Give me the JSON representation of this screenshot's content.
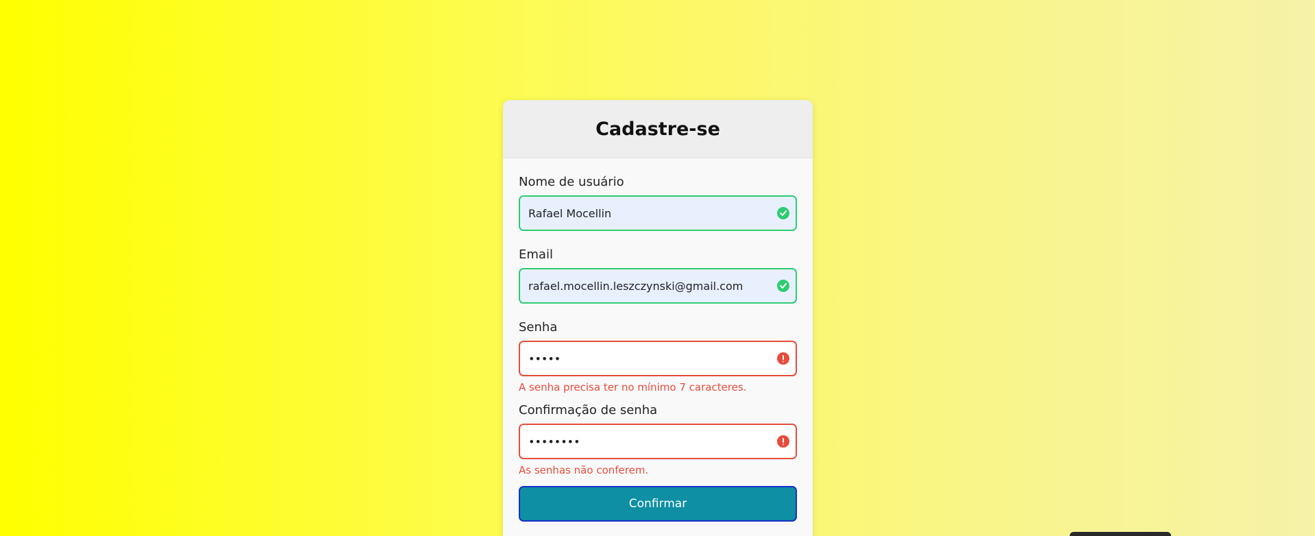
{
  "header": {
    "title": "Cadastre-se"
  },
  "fields": {
    "username": {
      "label": "Nome de usuário",
      "value": "Rafael Mocellin",
      "status": "success"
    },
    "email": {
      "label": "Email",
      "value": "rafael.mocellin.leszczynski@gmail.com",
      "status": "success"
    },
    "password": {
      "label": "Senha",
      "value": "•••••",
      "status": "error",
      "error": "A senha precisa ter no mínimo 7 caracteres."
    },
    "password_confirm": {
      "label": "Confirmação de senha",
      "value": "••••••••",
      "status": "error",
      "error": "As senhas não conferem."
    }
  },
  "submit": {
    "label": "Confirmar"
  },
  "colors": {
    "success": "#2ecc71",
    "error": "#e74c3c",
    "button": "#0e8fa3",
    "button_border": "#1a2ec9"
  },
  "icons": {
    "success": "check-circle-icon",
    "error": "exclamation-circle-icon"
  }
}
